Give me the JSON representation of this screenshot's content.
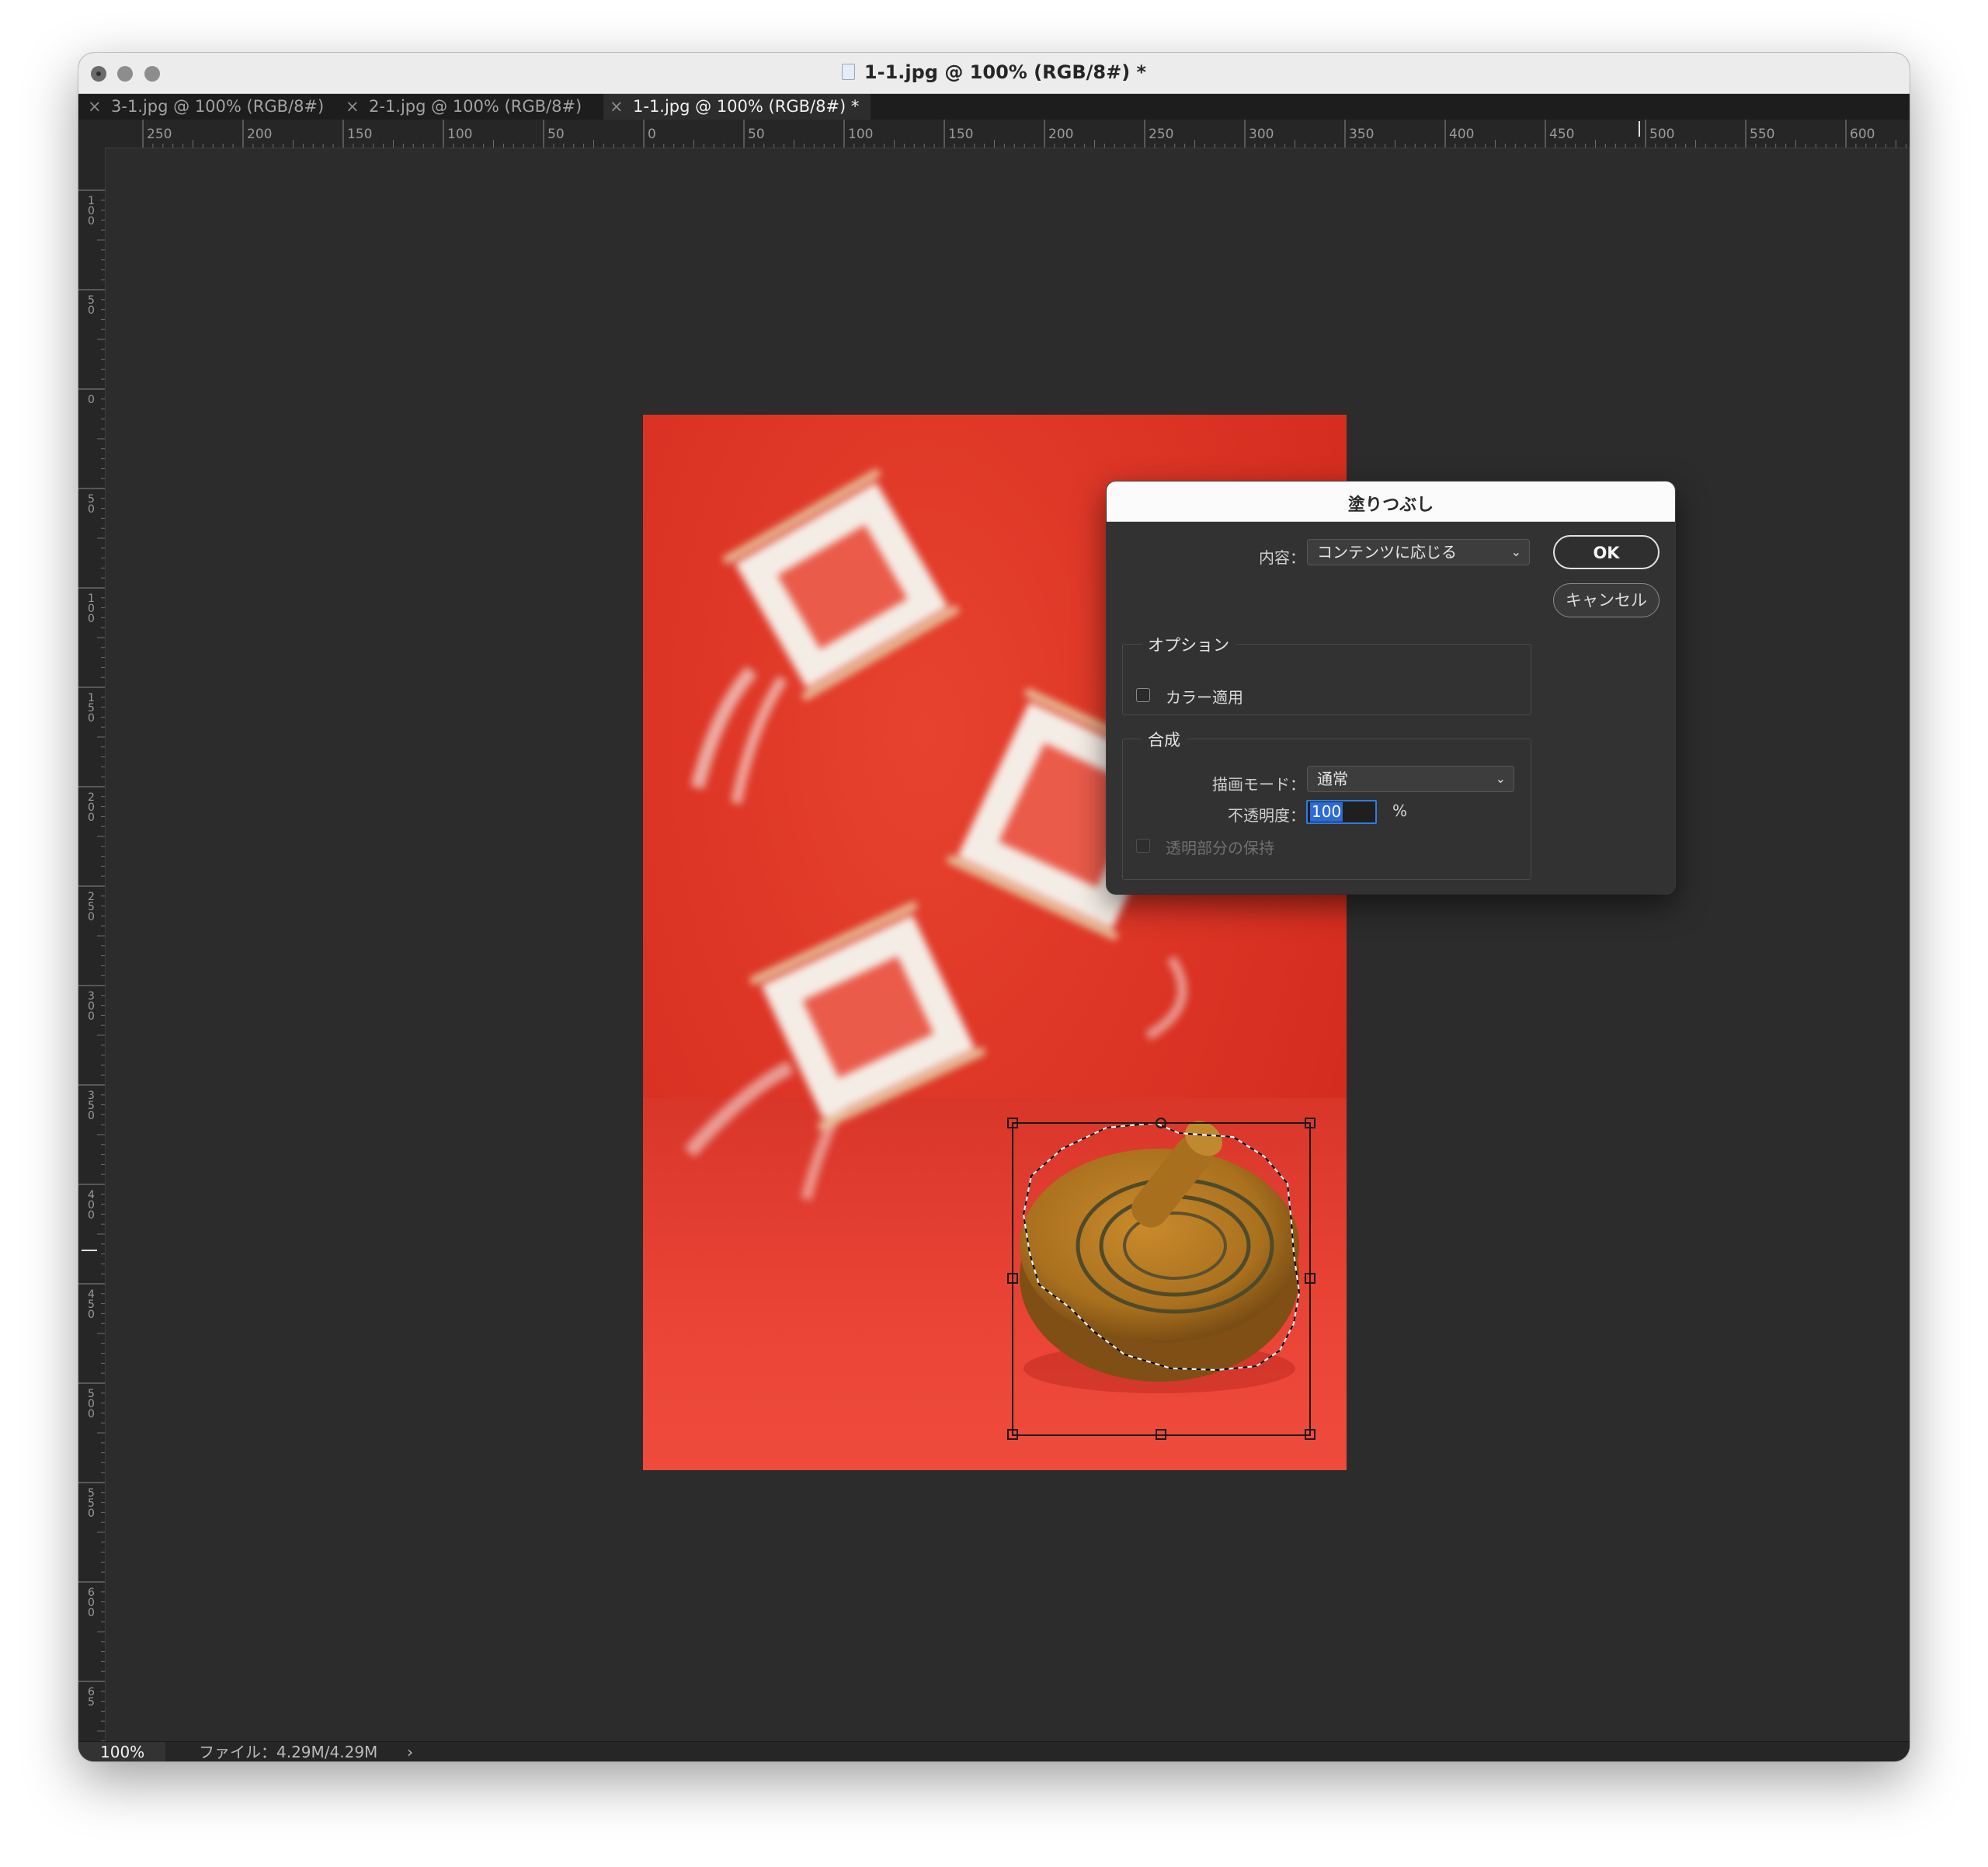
{
  "window": {
    "title": "1-1.jpg @ 100% (RGB/8#) *"
  },
  "tabs": [
    {
      "close": "×",
      "label": "3-1.jpg @ 100% (RGB/8#)",
      "active": false
    },
    {
      "close": "×",
      "label": "2-1.jpg @ 100% (RGB/8#)",
      "active": false
    },
    {
      "close": "×",
      "label": "1-1.jpg @ 100% (RGB/8#) *",
      "active": true
    }
  ],
  "rulers": {
    "top_labels": [
      "250",
      "200",
      "150",
      "100",
      "50",
      "0",
      "50",
      "100",
      "150",
      "200",
      "250",
      "300",
      "350",
      "400",
      "450",
      "500",
      "550",
      "600"
    ],
    "left_labels": [
      "100",
      "50",
      "0",
      "50",
      "100",
      "150",
      "200",
      "250",
      "300",
      "350",
      "400",
      "450",
      "500",
      "550",
      "600",
      "65"
    ]
  },
  "dialog": {
    "title": "塗りつぶし",
    "content_label": "内容：",
    "content_value": "コンテンツに応じる",
    "ok_label": "OK",
    "cancel_label": "キャンセル",
    "options_group": "オプション",
    "color_adapt_label": "カラー適用",
    "color_adapt_checked": false,
    "blend_group": "合成",
    "mode_label": "描画モード：",
    "mode_value": "通常",
    "opacity_label": "不透明度：",
    "opacity_value": "100",
    "opacity_unit": "%",
    "preserve_label": "透明部分の保持",
    "preserve_checked": false,
    "preserve_enabled": false
  },
  "status": {
    "zoom": "100%",
    "file_info": "ファイル：4.29M/4.29M",
    "arrow": "›"
  },
  "colors": {
    "canvas_bg": "#2c2c2c",
    "photo_red": "#dc3425",
    "focus_blue": "#2f7ce0"
  },
  "icons": {
    "chevron": "chevron-down-icon",
    "tab_close": "close-icon"
  }
}
